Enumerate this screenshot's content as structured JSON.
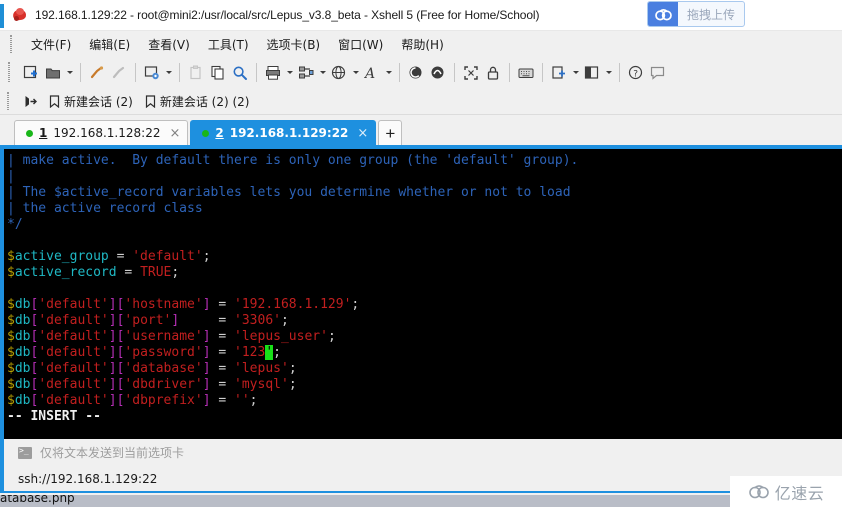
{
  "window": {
    "title": "192.168.1.129:22 - root@mini2:/usr/local/src/Lepus_v3.8_beta - Xshell 5 (Free for Home/School)",
    "app_icon": "xshell-icon"
  },
  "upload": {
    "label": "拖拽上传",
    "icon": "cloud-upload-icon"
  },
  "menu": {
    "items": [
      {
        "label": "文件(F)"
      },
      {
        "label": "编辑(E)"
      },
      {
        "label": "查看(V)"
      },
      {
        "label": "工具(T)"
      },
      {
        "label": "选项卡(B)"
      },
      {
        "label": "窗口(W)"
      },
      {
        "label": "帮助(H)"
      }
    ]
  },
  "toolbar": {
    "buttons": [
      {
        "name": "new-session-icon",
        "arrow": false
      },
      {
        "name": "open-folder-icon",
        "arrow": true
      },
      {
        "sep": true
      },
      {
        "name": "connect-icon",
        "arrow": false
      },
      {
        "name": "disconnect-icon",
        "arrow": false
      },
      {
        "sep": true
      },
      {
        "name": "session-properties-icon",
        "arrow": true
      },
      {
        "sep": true
      },
      {
        "name": "paste-plain-icon",
        "arrow": false
      },
      {
        "name": "copy-icon",
        "arrow": false
      },
      {
        "name": "find-icon",
        "arrow": false
      },
      {
        "sep": true
      },
      {
        "name": "print-icon",
        "arrow": true
      },
      {
        "name": "transfer-file-icon",
        "arrow": true
      },
      {
        "name": "globe-encoding-icon",
        "arrow": true
      },
      {
        "name": "font-icon",
        "arrow": true
      },
      {
        "sep": true
      },
      {
        "name": "log-icon",
        "arrow": false
      },
      {
        "name": "compose-icon",
        "arrow": false
      },
      {
        "sep": true
      },
      {
        "name": "fullscreen-icon",
        "arrow": false
      },
      {
        "name": "lock-icon",
        "arrow": false
      },
      {
        "sep": true
      },
      {
        "name": "keyboard-icon",
        "arrow": false
      },
      {
        "sep": true
      },
      {
        "name": "add-layout-icon",
        "arrow": true
      },
      {
        "name": "split-layout-icon",
        "arrow": true
      },
      {
        "sep": true
      },
      {
        "name": "help-icon",
        "arrow": false
      },
      {
        "name": "feedback-icon",
        "arrow": false
      }
    ]
  },
  "bookmarks": {
    "overflow_icon": "bookmark-jump-icon",
    "items": [
      {
        "icon": "bookmark-icon",
        "label": "新建会话 (2)"
      },
      {
        "icon": "bookmark-icon",
        "label": "新建会话 (2) (2)"
      }
    ]
  },
  "tabs": {
    "items": [
      {
        "num": "1",
        "label": "192.168.1.128:22",
        "active": false,
        "status": "connected",
        "close": "×"
      },
      {
        "num": "2",
        "label": "192.168.1.129:22",
        "active": true,
        "status": "connected",
        "close": "×"
      }
    ],
    "add_label": "+"
  },
  "terminal": {
    "lines": [
      [
        {
          "t": "| make active.  By default there is only one group (the 'default' group).",
          "c": "c-comment"
        }
      ],
      [
        {
          "t": "|",
          "c": "c-comment"
        }
      ],
      [
        {
          "t": "| The $active_record variables lets you determine whether or not to load",
          "c": "c-comment"
        }
      ],
      [
        {
          "t": "| the active record class",
          "c": "c-comment"
        }
      ],
      [
        {
          "t": "*/",
          "c": "c-comment"
        }
      ],
      [
        {
          "t": "",
          "c": "c-op"
        }
      ],
      [
        {
          "t": "$",
          "c": "c-var"
        },
        {
          "t": "active_group",
          "c": "c-ident"
        },
        {
          "t": " = ",
          "c": "c-op"
        },
        {
          "t": "'default'",
          "c": "c-str"
        },
        {
          "t": ";",
          "c": "c-semi"
        }
      ],
      [
        {
          "t": "$",
          "c": "c-var"
        },
        {
          "t": "active_record",
          "c": "c-ident"
        },
        {
          "t": " = ",
          "c": "c-op"
        },
        {
          "t": "TRUE",
          "c": "c-const"
        },
        {
          "t": ";",
          "c": "c-semi"
        }
      ],
      [
        {
          "t": "",
          "c": "c-op"
        }
      ],
      [
        {
          "t": "$",
          "c": "c-var"
        },
        {
          "t": "db",
          "c": "c-ident"
        },
        {
          "t": "[",
          "c": "c-bracket"
        },
        {
          "t": "'default'",
          "c": "c-str"
        },
        {
          "t": "][",
          "c": "c-bracket"
        },
        {
          "t": "'hostname'",
          "c": "c-str"
        },
        {
          "t": "]",
          "c": "c-bracket"
        },
        {
          "t": " = ",
          "c": "c-op"
        },
        {
          "t": "'192.168.1.129'",
          "c": "c-str"
        },
        {
          "t": ";",
          "c": "c-semi"
        }
      ],
      [
        {
          "t": "$",
          "c": "c-var"
        },
        {
          "t": "db",
          "c": "c-ident"
        },
        {
          "t": "[",
          "c": "c-bracket"
        },
        {
          "t": "'default'",
          "c": "c-str"
        },
        {
          "t": "][",
          "c": "c-bracket"
        },
        {
          "t": "'port'",
          "c": "c-str"
        },
        {
          "t": "]",
          "c": "c-bracket"
        },
        {
          "t": "     = ",
          "c": "c-op"
        },
        {
          "t": "'3306'",
          "c": "c-str"
        },
        {
          "t": ";",
          "c": "c-semi"
        }
      ],
      [
        {
          "t": "$",
          "c": "c-var"
        },
        {
          "t": "db",
          "c": "c-ident"
        },
        {
          "t": "[",
          "c": "c-bracket"
        },
        {
          "t": "'default'",
          "c": "c-str"
        },
        {
          "t": "][",
          "c": "c-bracket"
        },
        {
          "t": "'username'",
          "c": "c-str"
        },
        {
          "t": "]",
          "c": "c-bracket"
        },
        {
          "t": " = ",
          "c": "c-op"
        },
        {
          "t": "'lepus_user'",
          "c": "c-str"
        },
        {
          "t": ";",
          "c": "c-semi"
        }
      ],
      [
        {
          "t": "$",
          "c": "c-var"
        },
        {
          "t": "db",
          "c": "c-ident"
        },
        {
          "t": "[",
          "c": "c-bracket"
        },
        {
          "t": "'default'",
          "c": "c-str"
        },
        {
          "t": "][",
          "c": "c-bracket"
        },
        {
          "t": "'password'",
          "c": "c-str"
        },
        {
          "t": "]",
          "c": "c-bracket"
        },
        {
          "t": " = ",
          "c": "c-op"
        },
        {
          "t": "'123",
          "c": "c-str"
        },
        {
          "t": "'",
          "c": "cursor"
        },
        {
          "t": ";",
          "c": "c-semi"
        }
      ],
      [
        {
          "t": "$",
          "c": "c-var"
        },
        {
          "t": "db",
          "c": "c-ident"
        },
        {
          "t": "[",
          "c": "c-bracket"
        },
        {
          "t": "'default'",
          "c": "c-str"
        },
        {
          "t": "][",
          "c": "c-bracket"
        },
        {
          "t": "'database'",
          "c": "c-str"
        },
        {
          "t": "]",
          "c": "c-bracket"
        },
        {
          "t": " = ",
          "c": "c-op"
        },
        {
          "t": "'lepus'",
          "c": "c-str"
        },
        {
          "t": ";",
          "c": "c-semi"
        }
      ],
      [
        {
          "t": "$",
          "c": "c-var"
        },
        {
          "t": "db",
          "c": "c-ident"
        },
        {
          "t": "[",
          "c": "c-bracket"
        },
        {
          "t": "'default'",
          "c": "c-str"
        },
        {
          "t": "][",
          "c": "c-bracket"
        },
        {
          "t": "'dbdriver'",
          "c": "c-str"
        },
        {
          "t": "]",
          "c": "c-bracket"
        },
        {
          "t": " = ",
          "c": "c-op"
        },
        {
          "t": "'mysql'",
          "c": "c-str"
        },
        {
          "t": ";",
          "c": "c-semi"
        }
      ],
      [
        {
          "t": "$",
          "c": "c-var"
        },
        {
          "t": "db",
          "c": "c-ident"
        },
        {
          "t": "[",
          "c": "c-bracket"
        },
        {
          "t": "'default'",
          "c": "c-str"
        },
        {
          "t": "][",
          "c": "c-bracket"
        },
        {
          "t": "'dbprefix'",
          "c": "c-str"
        },
        {
          "t": "]",
          "c": "c-bracket"
        },
        {
          "t": " = ",
          "c": "c-op"
        },
        {
          "t": "''",
          "c": "c-str"
        },
        {
          "t": ";",
          "c": "c-semi"
        }
      ],
      [
        {
          "t": "-- INSERT --",
          "c": "c-white"
        }
      ]
    ]
  },
  "sendbar": {
    "label": "仅将文本发送到当前选项卡",
    "icon": "terminal-mini-icon"
  },
  "statusbar": {
    "label": "ssh://192.168.1.129:22"
  },
  "taskbar": {
    "item_label": "atabase.php"
  },
  "watermark": {
    "label": "亿速云",
    "icon": "yisuyun-cloud-logo"
  },
  "colors": {
    "accent_blue": "#1e90df",
    "tab_active_bg": "#1e90df",
    "terminal_bg": "#000000",
    "cursor_green": "#18e018",
    "comment_blue": "#2d63b8",
    "string_red": "#c21f1f",
    "ident_cyan": "#1fb8c4",
    "bracket_magenta": "#b62fb6",
    "var_yellow": "#b8a000",
    "upload_btn_blue": "#4a7fe0",
    "chrome_bg": "#f0f0f0"
  }
}
